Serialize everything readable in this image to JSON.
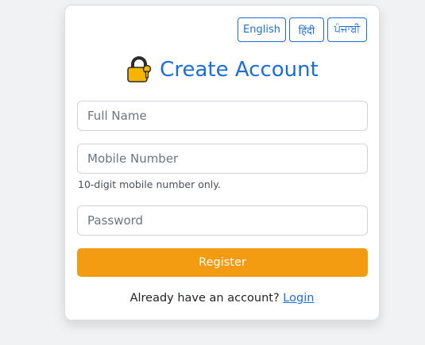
{
  "languages": {
    "english": "English",
    "hindi": "हिंदी",
    "punjabi": "ਪੰਜਾਬੀ"
  },
  "header": {
    "title": "Create Account",
    "icon": "lock-icon"
  },
  "form": {
    "full_name_placeholder": "Full Name",
    "mobile_placeholder": "Mobile Number",
    "mobile_helper": "10-digit mobile number only.",
    "password_placeholder": "Password",
    "register_label": "Register"
  },
  "footer": {
    "prompt": "Already have an account?",
    "login_link": "Login"
  },
  "colors": {
    "accent": "#1a6ed8",
    "register": "#f39c12",
    "lock_body": "#f4b400",
    "lock_shackle": "#2b2b2b"
  }
}
